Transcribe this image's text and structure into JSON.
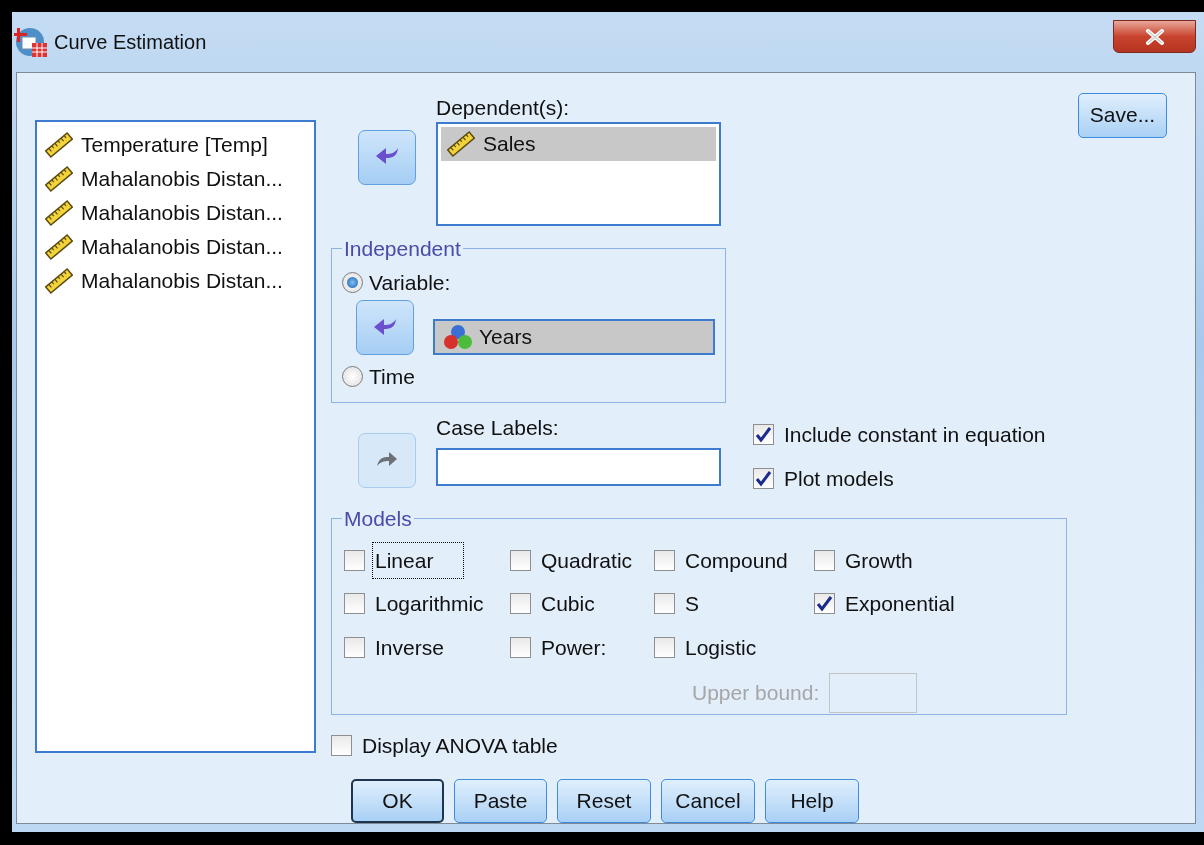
{
  "window": {
    "title": "Curve Estimation"
  },
  "source_variables": [
    {
      "label": "Temperature [Temp]"
    },
    {
      "label": "Mahalanobis Distan..."
    },
    {
      "label": "Mahalanobis Distan..."
    },
    {
      "label": "Mahalanobis Distan..."
    },
    {
      "label": "Mahalanobis Distan..."
    }
  ],
  "transfer_buttons": [
    {
      "disabled": false
    },
    {
      "disabled": false
    },
    {
      "disabled": true
    }
  ],
  "dependents": {
    "label": "Dependent(s):",
    "items": [
      {
        "label": "Sales",
        "selected": true
      }
    ]
  },
  "save_button": {
    "label": "Save..."
  },
  "independent": {
    "legend": "Independent",
    "options": [
      {
        "label": "Variable:",
        "selected": true
      },
      {
        "label": "Time",
        "selected": false
      }
    ],
    "variable": {
      "label": "Years",
      "selected": true
    }
  },
  "case_labels": {
    "label": "Case Labels:"
  },
  "options": [
    {
      "label": "Include constant in equation",
      "checked": true
    },
    {
      "label": "Plot models",
      "checked": true
    }
  ],
  "models": {
    "legend": "Models",
    "items": [
      {
        "label": "Linear",
        "checked": false,
        "focused": true
      },
      {
        "label": "Quadratic",
        "checked": false,
        "focused": false
      },
      {
        "label": "Compound",
        "checked": false,
        "focused": false
      },
      {
        "label": "Growth",
        "checked": false,
        "focused": false
      },
      {
        "label": "Logarithmic",
        "checked": false,
        "focused": false
      },
      {
        "label": "Cubic",
        "checked": false,
        "focused": false
      },
      {
        "label": "S",
        "checked": false,
        "focused": false
      },
      {
        "label": "Exponential",
        "checked": true,
        "focused": false
      },
      {
        "label": "Inverse",
        "checked": false,
        "focused": false
      },
      {
        "label": "Power:",
        "checked": false,
        "focused": false
      },
      {
        "label": "Logistic",
        "checked": false,
        "focused": false
      }
    ],
    "upper_bound": {
      "label": "Upper bound:",
      "disabled": true
    }
  },
  "display_anova": {
    "label": "Display ANOVA table",
    "checked": false
  },
  "buttons": [
    {
      "label": "OK",
      "default": true
    },
    {
      "label": "Paste",
      "default": false
    },
    {
      "label": "Reset",
      "default": false
    },
    {
      "label": "Cancel",
      "default": false
    },
    {
      "label": "Help",
      "default": false
    }
  ]
}
